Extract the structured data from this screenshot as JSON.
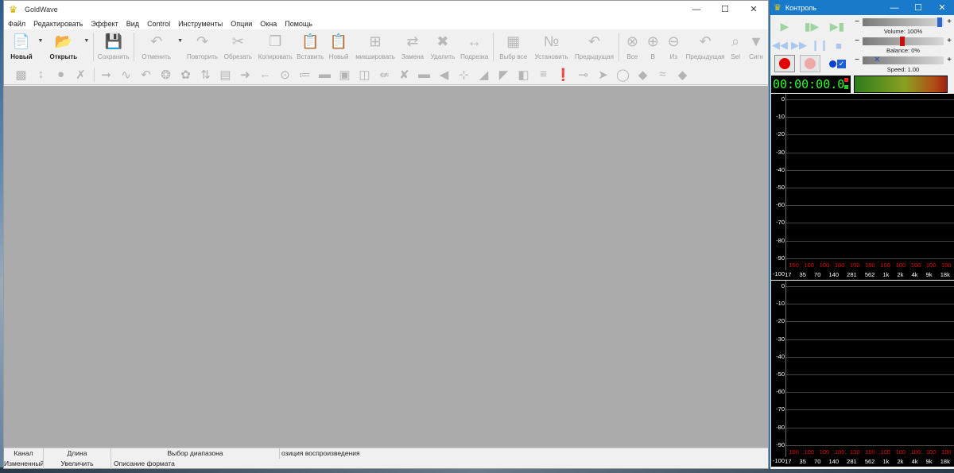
{
  "main_window": {
    "title": "GoldWave",
    "menu": [
      "Файл",
      "Редактировать",
      "Эффект",
      "Вид",
      "Control",
      "Инструменты",
      "Опции",
      "Окна",
      "Помощь"
    ],
    "toolbar": [
      {
        "label": "Новый",
        "icon": "new-file-icon",
        "active": true,
        "dropdown": true
      },
      {
        "label": "Открыть",
        "icon": "open-folder-icon",
        "active": true,
        "dropdown": true
      },
      {
        "label": "Сохранить",
        "icon": "save-icon"
      },
      {
        "label": "Отменить",
        "icon": "undo-icon",
        "dropdown": true
      },
      {
        "label": "Повторить",
        "icon": "redo-icon"
      },
      {
        "label": "Обрезать",
        "icon": "cut-icon"
      },
      {
        "label": "Копировать",
        "icon": "copy-icon"
      },
      {
        "label": "Вставить",
        "icon": "paste-icon"
      },
      {
        "label": "Новый",
        "icon": "paste-new-icon"
      },
      {
        "label": "микшировать",
        "icon": "mix-icon"
      },
      {
        "label": "Замена",
        "icon": "replace-icon"
      },
      {
        "label": "Удалить",
        "icon": "delete-icon"
      },
      {
        "label": "Подрезка",
        "icon": "trim-icon"
      },
      {
        "label": "Выбр все",
        "icon": "select-all-icon"
      },
      {
        "label": "Установить",
        "icon": "set-icon"
      },
      {
        "label": "Предыдущая",
        "icon": "previous-icon"
      },
      {
        "label": "Все",
        "icon": "zoom-all-icon"
      },
      {
        "label": "В",
        "icon": "zoom-in-icon"
      },
      {
        "label": "Из",
        "icon": "zoom-out-icon"
      },
      {
        "label": "Предыдущая",
        "icon": "zoom-previous-icon"
      },
      {
        "label": "Sel",
        "icon": "zoom-sel-icon"
      },
      {
        "label": "Сигн",
        "icon": "signal-icon"
      }
    ],
    "status": {
      "top": [
        "Канал",
        "Длина",
        "Выбор диапазона",
        "озиция воспроизведения"
      ],
      "bottom": [
        "Измененный",
        "Увеличить",
        "Описание формата"
      ]
    }
  },
  "control_window": {
    "title": "Контроль",
    "volume_label": "Volume: 100%",
    "balance_label": "Balance: 0%",
    "speed_label": "Speed: 1.00",
    "volume_level": 1.0,
    "balance_level": 0.0,
    "speed_level": 1.0,
    "time": "00:00:00.0",
    "spectrum": {
      "y_ticks": [
        "0",
        "-10",
        "-20",
        "-30",
        "-40",
        "-50",
        "-60",
        "-70",
        "-80",
        "-90",
        "-100"
      ],
      "values": [
        "100",
        "100",
        "100",
        "100",
        "100",
        "100",
        "100",
        "100",
        "100",
        "100",
        "100"
      ],
      "x_ticks": [
        "17",
        "35",
        "70",
        "140",
        "281",
        "562",
        "1k",
        "2k",
        "4k",
        "9k",
        "18k"
      ]
    }
  }
}
